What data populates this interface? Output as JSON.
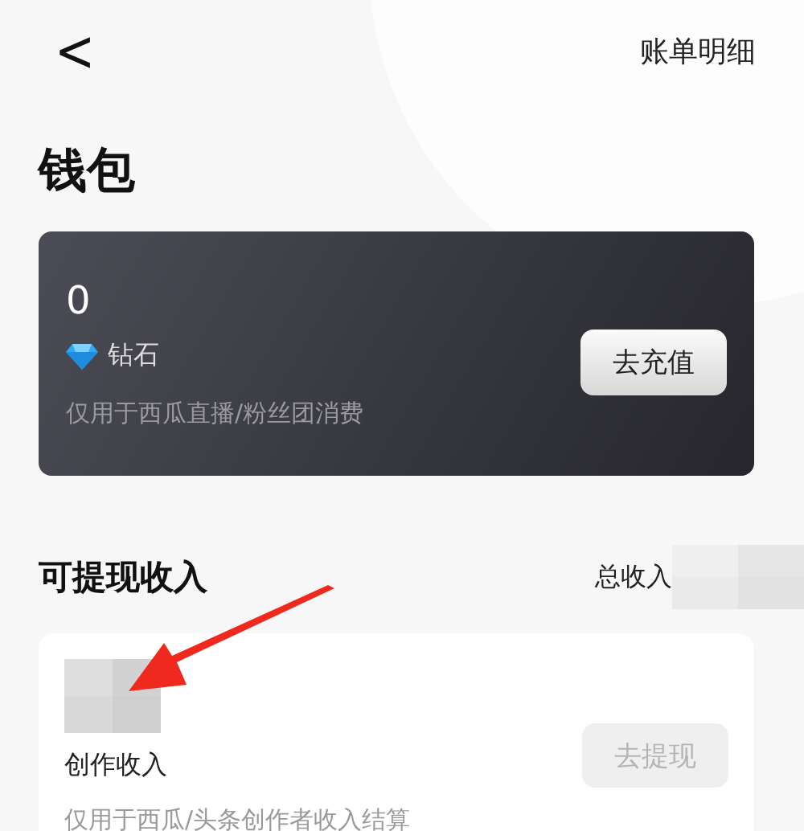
{
  "header": {
    "back": "<",
    "action": "账单明细"
  },
  "title": "钱包",
  "diamond_card": {
    "amount": "0",
    "unit": "钻石",
    "button": "去充值",
    "note": "仅用于西瓜直播/粉丝团消费"
  },
  "income": {
    "title": "可提现收入",
    "total_label": "总收入",
    "items": [
      {
        "name": "创作收入",
        "button": "去提现",
        "disabled": true,
        "note": "仅用于西瓜/头条创作者收入结算"
      }
    ]
  }
}
